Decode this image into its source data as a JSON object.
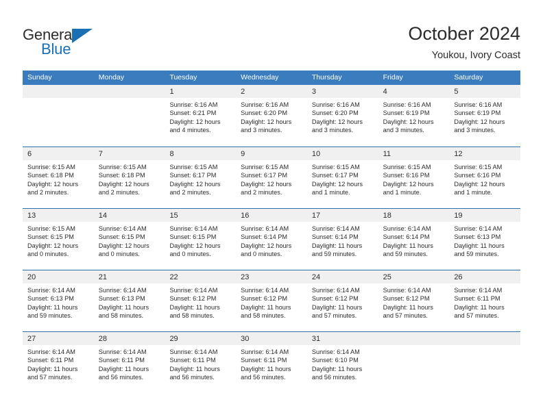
{
  "brand": {
    "name_top": "General",
    "name_bottom": "Blue",
    "accent_color": "#1a6fb5"
  },
  "header": {
    "title": "October 2024",
    "subtitle": "Youkou, Ivory Coast"
  },
  "colors": {
    "weekday_header_bg": "#3a7cbe",
    "week_divider": "#2a6fae",
    "day_strip_bg": "#f0f0f0",
    "text": "#2b2b2b"
  },
  "weekdays": [
    "Sunday",
    "Monday",
    "Tuesday",
    "Wednesday",
    "Thursday",
    "Friday",
    "Saturday"
  ],
  "weeks": [
    [
      {
        "day": "",
        "empty": true
      },
      {
        "day": "",
        "empty": true
      },
      {
        "day": "1",
        "sunrise": "Sunrise: 6:16 AM",
        "sunset": "Sunset: 6:21 PM",
        "daylight_1": "Daylight: 12 hours",
        "daylight_2": "and 4 minutes."
      },
      {
        "day": "2",
        "sunrise": "Sunrise: 6:16 AM",
        "sunset": "Sunset: 6:20 PM",
        "daylight_1": "Daylight: 12 hours",
        "daylight_2": "and 3 minutes."
      },
      {
        "day": "3",
        "sunrise": "Sunrise: 6:16 AM",
        "sunset": "Sunset: 6:20 PM",
        "daylight_1": "Daylight: 12 hours",
        "daylight_2": "and 3 minutes."
      },
      {
        "day": "4",
        "sunrise": "Sunrise: 6:16 AM",
        "sunset": "Sunset: 6:19 PM",
        "daylight_1": "Daylight: 12 hours",
        "daylight_2": "and 3 minutes."
      },
      {
        "day": "5",
        "sunrise": "Sunrise: 6:16 AM",
        "sunset": "Sunset: 6:19 PM",
        "daylight_1": "Daylight: 12 hours",
        "daylight_2": "and 3 minutes."
      }
    ],
    [
      {
        "day": "6",
        "sunrise": "Sunrise: 6:15 AM",
        "sunset": "Sunset: 6:18 PM",
        "daylight_1": "Daylight: 12 hours",
        "daylight_2": "and 2 minutes."
      },
      {
        "day": "7",
        "sunrise": "Sunrise: 6:15 AM",
        "sunset": "Sunset: 6:18 PM",
        "daylight_1": "Daylight: 12 hours",
        "daylight_2": "and 2 minutes."
      },
      {
        "day": "8",
        "sunrise": "Sunrise: 6:15 AM",
        "sunset": "Sunset: 6:17 PM",
        "daylight_1": "Daylight: 12 hours",
        "daylight_2": "and 2 minutes."
      },
      {
        "day": "9",
        "sunrise": "Sunrise: 6:15 AM",
        "sunset": "Sunset: 6:17 PM",
        "daylight_1": "Daylight: 12 hours",
        "daylight_2": "and 2 minutes."
      },
      {
        "day": "10",
        "sunrise": "Sunrise: 6:15 AM",
        "sunset": "Sunset: 6:17 PM",
        "daylight_1": "Daylight: 12 hours",
        "daylight_2": "and 1 minute."
      },
      {
        "day": "11",
        "sunrise": "Sunrise: 6:15 AM",
        "sunset": "Sunset: 6:16 PM",
        "daylight_1": "Daylight: 12 hours",
        "daylight_2": "and 1 minute."
      },
      {
        "day": "12",
        "sunrise": "Sunrise: 6:15 AM",
        "sunset": "Sunset: 6:16 PM",
        "daylight_1": "Daylight: 12 hours",
        "daylight_2": "and 1 minute."
      }
    ],
    [
      {
        "day": "13",
        "sunrise": "Sunrise: 6:15 AM",
        "sunset": "Sunset: 6:15 PM",
        "daylight_1": "Daylight: 12 hours",
        "daylight_2": "and 0 minutes."
      },
      {
        "day": "14",
        "sunrise": "Sunrise: 6:14 AM",
        "sunset": "Sunset: 6:15 PM",
        "daylight_1": "Daylight: 12 hours",
        "daylight_2": "and 0 minutes."
      },
      {
        "day": "15",
        "sunrise": "Sunrise: 6:14 AM",
        "sunset": "Sunset: 6:15 PM",
        "daylight_1": "Daylight: 12 hours",
        "daylight_2": "and 0 minutes."
      },
      {
        "day": "16",
        "sunrise": "Sunrise: 6:14 AM",
        "sunset": "Sunset: 6:14 PM",
        "daylight_1": "Daylight: 12 hours",
        "daylight_2": "and 0 minutes."
      },
      {
        "day": "17",
        "sunrise": "Sunrise: 6:14 AM",
        "sunset": "Sunset: 6:14 PM",
        "daylight_1": "Daylight: 11 hours",
        "daylight_2": "and 59 minutes."
      },
      {
        "day": "18",
        "sunrise": "Sunrise: 6:14 AM",
        "sunset": "Sunset: 6:14 PM",
        "daylight_1": "Daylight: 11 hours",
        "daylight_2": "and 59 minutes."
      },
      {
        "day": "19",
        "sunrise": "Sunrise: 6:14 AM",
        "sunset": "Sunset: 6:13 PM",
        "daylight_1": "Daylight: 11 hours",
        "daylight_2": "and 59 minutes."
      }
    ],
    [
      {
        "day": "20",
        "sunrise": "Sunrise: 6:14 AM",
        "sunset": "Sunset: 6:13 PM",
        "daylight_1": "Daylight: 11 hours",
        "daylight_2": "and 59 minutes."
      },
      {
        "day": "21",
        "sunrise": "Sunrise: 6:14 AM",
        "sunset": "Sunset: 6:13 PM",
        "daylight_1": "Daylight: 11 hours",
        "daylight_2": "and 58 minutes."
      },
      {
        "day": "22",
        "sunrise": "Sunrise: 6:14 AM",
        "sunset": "Sunset: 6:12 PM",
        "daylight_1": "Daylight: 11 hours",
        "daylight_2": "and 58 minutes."
      },
      {
        "day": "23",
        "sunrise": "Sunrise: 6:14 AM",
        "sunset": "Sunset: 6:12 PM",
        "daylight_1": "Daylight: 11 hours",
        "daylight_2": "and 58 minutes."
      },
      {
        "day": "24",
        "sunrise": "Sunrise: 6:14 AM",
        "sunset": "Sunset: 6:12 PM",
        "daylight_1": "Daylight: 11 hours",
        "daylight_2": "and 57 minutes."
      },
      {
        "day": "25",
        "sunrise": "Sunrise: 6:14 AM",
        "sunset": "Sunset: 6:12 PM",
        "daylight_1": "Daylight: 11 hours",
        "daylight_2": "and 57 minutes."
      },
      {
        "day": "26",
        "sunrise": "Sunrise: 6:14 AM",
        "sunset": "Sunset: 6:11 PM",
        "daylight_1": "Daylight: 11 hours",
        "daylight_2": "and 57 minutes."
      }
    ],
    [
      {
        "day": "27",
        "sunrise": "Sunrise: 6:14 AM",
        "sunset": "Sunset: 6:11 PM",
        "daylight_1": "Daylight: 11 hours",
        "daylight_2": "and 57 minutes."
      },
      {
        "day": "28",
        "sunrise": "Sunrise: 6:14 AM",
        "sunset": "Sunset: 6:11 PM",
        "daylight_1": "Daylight: 11 hours",
        "daylight_2": "and 56 minutes."
      },
      {
        "day": "29",
        "sunrise": "Sunrise: 6:14 AM",
        "sunset": "Sunset: 6:11 PM",
        "daylight_1": "Daylight: 11 hours",
        "daylight_2": "and 56 minutes."
      },
      {
        "day": "30",
        "sunrise": "Sunrise: 6:14 AM",
        "sunset": "Sunset: 6:11 PM",
        "daylight_1": "Daylight: 11 hours",
        "daylight_2": "and 56 minutes."
      },
      {
        "day": "31",
        "sunrise": "Sunrise: 6:14 AM",
        "sunset": "Sunset: 6:10 PM",
        "daylight_1": "Daylight: 11 hours",
        "daylight_2": "and 56 minutes."
      },
      {
        "day": "",
        "empty": true
      },
      {
        "day": "",
        "empty": true
      }
    ]
  ]
}
